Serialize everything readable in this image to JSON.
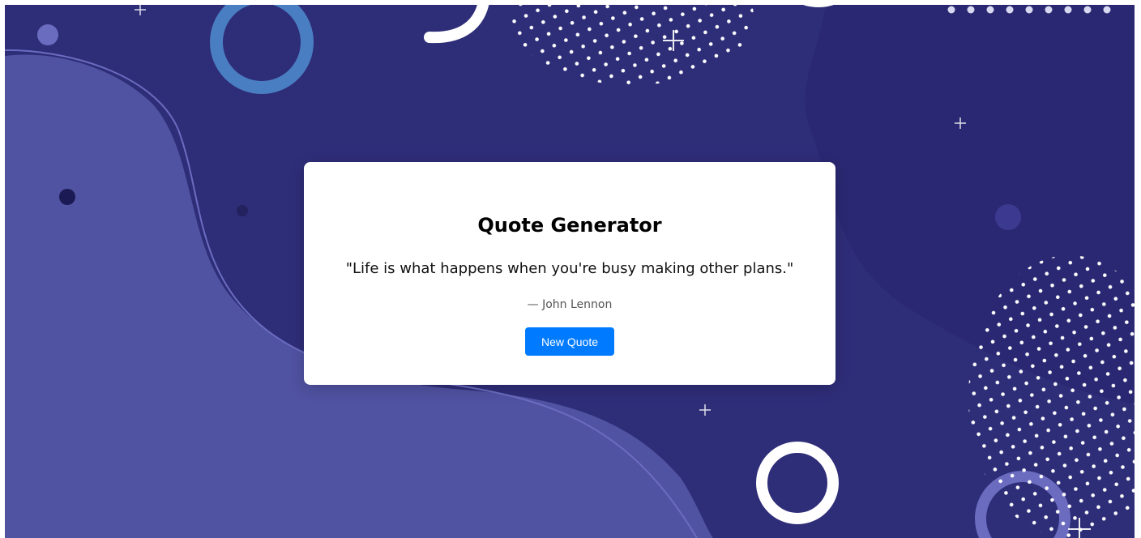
{
  "quote_card": {
    "title": "Quote Generator",
    "quote_text": "\"Life is what happens when you're busy making other plans.\"",
    "author": "— John Lennon",
    "button_label": "New Quote"
  },
  "colors": {
    "background_dark": "#2a2872",
    "background_mid": "#2e2d78",
    "blob_light": "#5052a2",
    "ring_blue": "#4a7ec2",
    "button_accent": "#007bff",
    "card_background": "#ffffff"
  }
}
